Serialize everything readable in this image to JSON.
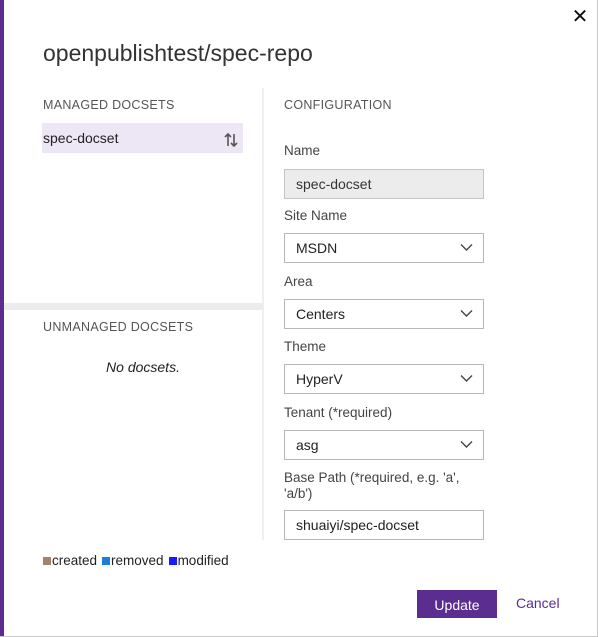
{
  "dialog": {
    "title": "openpublishtest/spec-repo",
    "close_icon": "close-icon",
    "accent_color": "#5c2d91"
  },
  "managed": {
    "heading": "MANAGED DOCSETS",
    "items": [
      {
        "label": "spec-docset",
        "icon": "sort-arrows-icon"
      }
    ]
  },
  "unmanaged": {
    "heading": "UNMANAGED DOCSETS",
    "empty_text": "No docsets."
  },
  "config": {
    "heading": "CONFIGURATION",
    "name": {
      "label": "Name",
      "value": "spec-docset"
    },
    "site_name": {
      "label": "Site Name",
      "value": "MSDN"
    },
    "area": {
      "label": "Area",
      "value": "Centers"
    },
    "theme": {
      "label": "Theme",
      "value": "HyperV"
    },
    "tenant": {
      "label": "Tenant (*required)",
      "value": "asg"
    },
    "base_path": {
      "label": "Base Path (*required, e.g. 'a', 'a/b')",
      "value": "shuaiyi/spec-docset"
    }
  },
  "legend": [
    {
      "label": "created",
      "color": "#a0826d"
    },
    {
      "label": "removed",
      "color": "#1e7fd6"
    },
    {
      "label": "modified",
      "color": "#1a1aff"
    }
  ],
  "footer": {
    "update_label": "Update",
    "cancel_label": "Cancel"
  }
}
